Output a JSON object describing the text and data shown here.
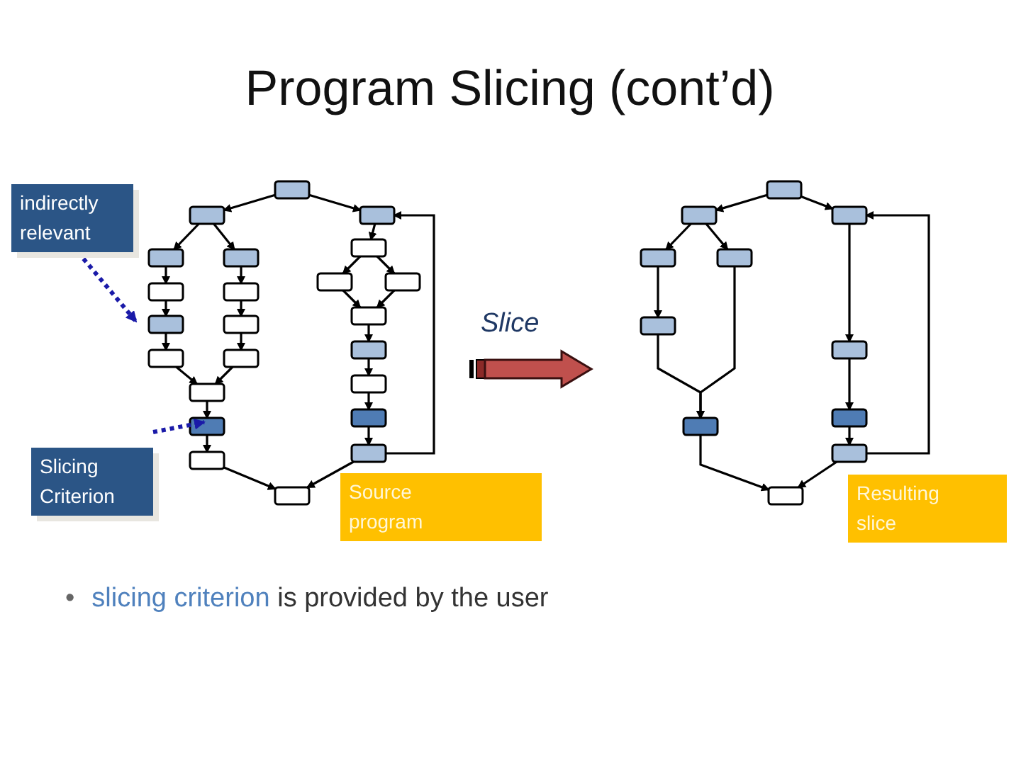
{
  "title": "Program Slicing (cont’d)",
  "callouts": [
    {
      "text": "indirectly relevant",
      "kind": "dark"
    },
    {
      "text": "Slicing Criterion",
      "kind": "dark"
    },
    {
      "text": "Source program",
      "kind": "orange"
    },
    {
      "text": "Resulting slice",
      "kind": "orange"
    }
  ],
  "arrow_label": "Slice",
  "graphs": [
    {
      "nodes": [
        {
          "kind": "relevant"
        },
        {
          "kind": "relevant"
        },
        {
          "kind": "relevant"
        },
        {
          "kind": "relevant"
        },
        {
          "kind": "relevant"
        },
        {
          "kind": "plain"
        },
        {
          "kind": "plain"
        },
        {
          "kind": "relevant"
        },
        {
          "kind": "plain"
        },
        {
          "kind": "plain"
        },
        {
          "kind": "plain"
        },
        {
          "kind": "plain"
        },
        {
          "kind": "criterion"
        },
        {
          "kind": "plain"
        },
        {
          "kind": "plain"
        },
        {
          "kind": "plain"
        },
        {
          "kind": "plain"
        },
        {
          "kind": "plain"
        },
        {
          "kind": "plain"
        },
        {
          "kind": "relevant"
        },
        {
          "kind": "plain"
        },
        {
          "kind": "criterion"
        },
        {
          "kind": "relevant"
        }
      ]
    },
    {
      "nodes": [
        {
          "kind": "relevant"
        },
        {
          "kind": "relevant"
        },
        {
          "kind": "relevant"
        },
        {
          "kind": "relevant"
        },
        {
          "kind": "relevant"
        },
        {
          "kind": "relevant"
        },
        {
          "kind": "criterion"
        },
        {
          "kind": "plain"
        },
        {
          "kind": "relevant"
        },
        {
          "kind": "criterion"
        },
        {
          "kind": "relevant"
        }
      ]
    }
  ],
  "bullet": {
    "marker": "•",
    "highlight": "slicing criterion",
    "rest": " is provided by the user"
  }
}
